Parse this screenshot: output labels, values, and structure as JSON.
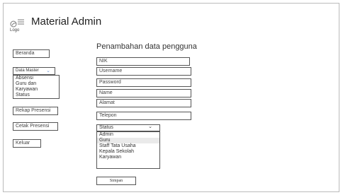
{
  "app": {
    "title": "Material Admin",
    "logo_label": "Logo"
  },
  "sidebar": {
    "beranda": "Beranda",
    "data_master": "Data Master",
    "data_master_items": [
      "Absensi",
      "Guru dan Karyawan",
      "Status"
    ],
    "rekap": "Rekap Presensi",
    "cetak": "Cetak Presensi",
    "keluar": "Keluar"
  },
  "form": {
    "title": "Penambahan data pengguna",
    "fields": [
      "NIK",
      "Username",
      "Password",
      "Name",
      "Alamat",
      "Telepon"
    ],
    "status_label": "Status",
    "status_options": [
      "Admin",
      "Guru",
      "Staff Tata Usaha",
      "Kepala Sekolah",
      "Karyawan"
    ],
    "submit": "Simpan"
  }
}
